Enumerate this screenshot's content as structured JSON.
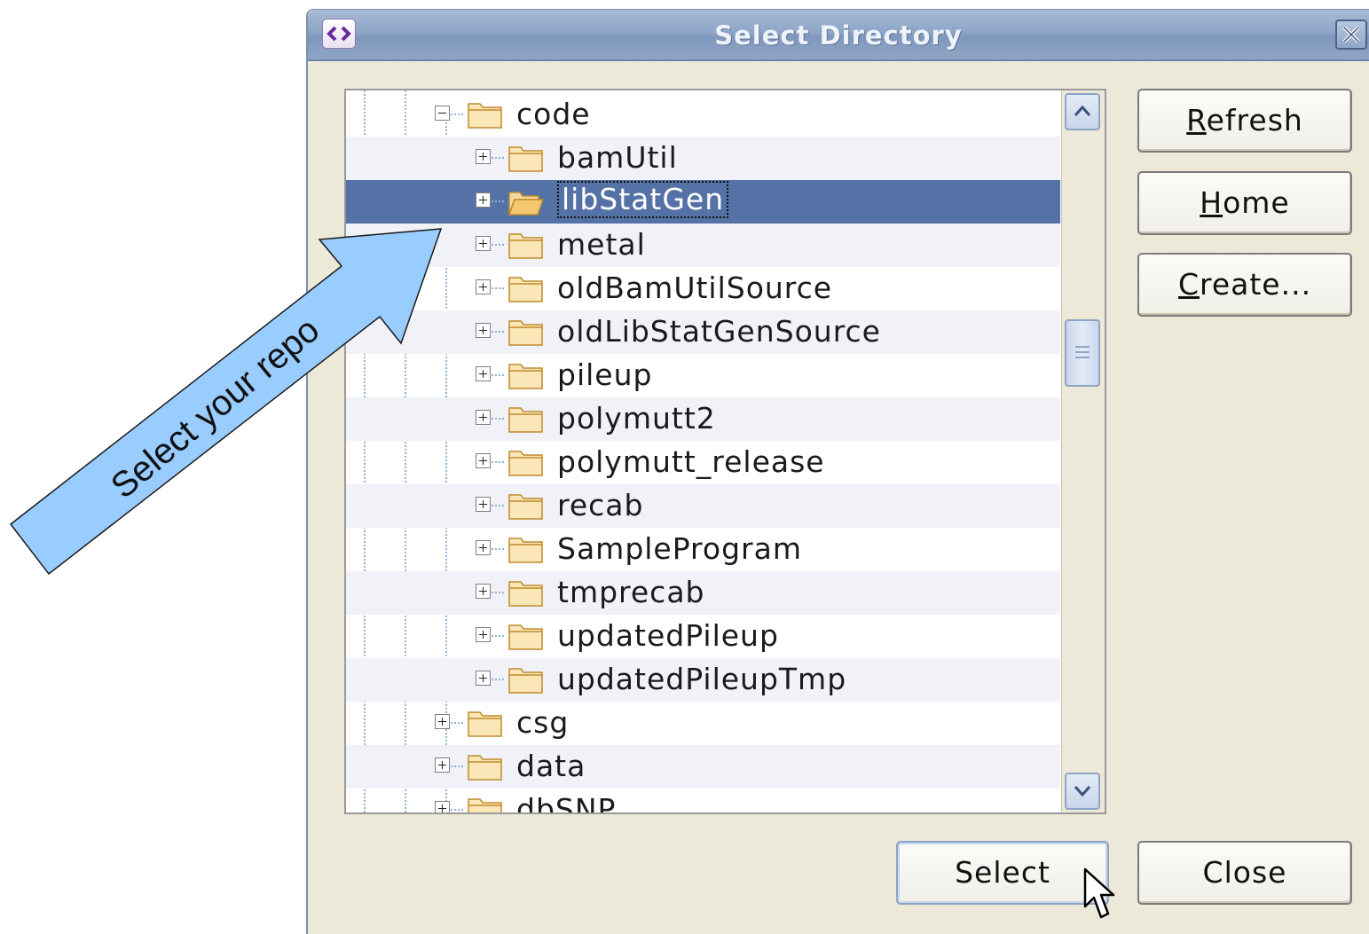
{
  "dialog": {
    "title": "Select Directory",
    "app_icon": "code-brackets-icon",
    "close_icon": "close-icon"
  },
  "tree": {
    "rows": [
      {
        "label": "code",
        "level": 1,
        "expanded": true
      },
      {
        "label": "bamUtil",
        "level": 2,
        "expanded": false
      },
      {
        "label": "libStatGen",
        "level": 2,
        "expanded": false,
        "selected": true
      },
      {
        "label": "metal",
        "level": 2,
        "expanded": false
      },
      {
        "label": "oldBamUtilSource",
        "level": 2,
        "expanded": false
      },
      {
        "label": "oldLibStatGenSource",
        "level": 2,
        "expanded": false
      },
      {
        "label": "pileup",
        "level": 2,
        "expanded": false
      },
      {
        "label": "polymutt2",
        "level": 2,
        "expanded": false
      },
      {
        "label": "polymutt_release",
        "level": 2,
        "expanded": false
      },
      {
        "label": "recab",
        "level": 2,
        "expanded": false
      },
      {
        "label": "SampleProgram",
        "level": 2,
        "expanded": false
      },
      {
        "label": "tmprecab",
        "level": 2,
        "expanded": false
      },
      {
        "label": "updatedPileup",
        "level": 2,
        "expanded": false
      },
      {
        "label": "updatedPileupTmp",
        "level": 2,
        "expanded": false
      },
      {
        "label": "csg",
        "level": 1,
        "expanded": false
      },
      {
        "label": "data",
        "level": 1,
        "expanded": false
      },
      {
        "label": "dbSNP",
        "level": 1,
        "expanded": false
      }
    ]
  },
  "buttons": {
    "refresh_mnemonic": "R",
    "refresh_rest": "efresh",
    "home_mnemonic": "H",
    "home_rest": "ome",
    "create_mnemonic": "C",
    "create_rest": "reate...",
    "select": "Select",
    "close": "Close"
  },
  "annotation": {
    "text": "Select your repo",
    "arrow_color": "#99ccff"
  },
  "colors": {
    "selection": "#5572a6",
    "dialog_bg": "#ece9d8",
    "folder": "#f5c870"
  }
}
